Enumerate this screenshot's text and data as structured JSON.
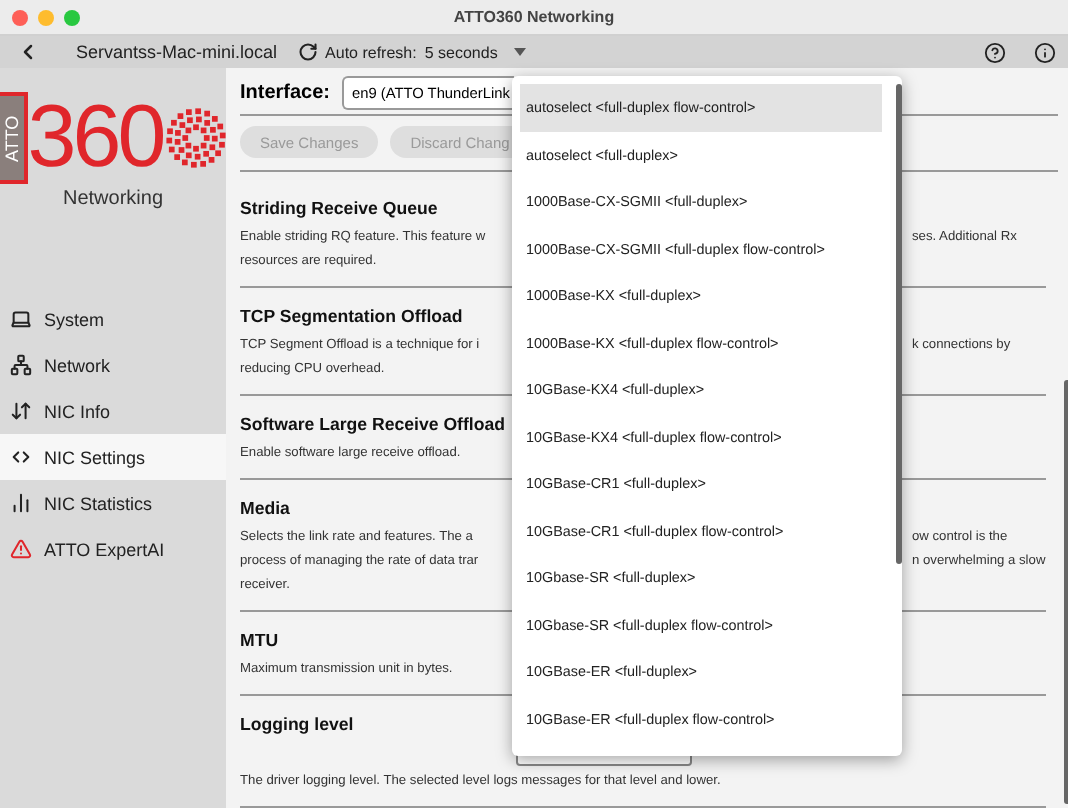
{
  "window": {
    "title": "ATTO360 Networking"
  },
  "toolbar": {
    "host": "Servantss-Mac-mini.local",
    "auto_refresh": "Auto refresh:",
    "interval": "5 seconds"
  },
  "logo": {
    "badge": "ATTO",
    "number": "360",
    "subtitle": "Networking"
  },
  "sidebar": {
    "items": [
      {
        "label": "System",
        "selected": false
      },
      {
        "label": "Network",
        "selected": false
      },
      {
        "label": "NIC Info",
        "selected": false
      },
      {
        "label": "NIC Settings",
        "selected": true
      },
      {
        "label": "NIC Statistics",
        "selected": false
      },
      {
        "label": "ATTO ExpertAI",
        "selected": false
      }
    ]
  },
  "interface": {
    "label": "Interface:",
    "value": "en9 (ATTO ThunderLink"
  },
  "buttons": [
    {
      "label": "Save Changes",
      "disabled": true
    },
    {
      "label": "Discard Chang",
      "disabled": true
    }
  ],
  "sections": [
    {
      "kind": "plain",
      "title": "Striding Receive Queue",
      "left_lines": [
        "Enable striding RQ feature. This feature w",
        "resources are required."
      ],
      "right_lines": [
        "ses. Additional Rx"
      ]
    },
    {
      "kind": "plain",
      "title": "TCP Segmentation Offload",
      "left_lines": [
        "TCP Segment Offload is a technique for i",
        "reducing CPU overhead."
      ],
      "right_lines": [
        "k connections by"
      ]
    },
    {
      "kind": "plain",
      "title": "Software Large Receive Offload",
      "left_lines": [
        "Enable software large receive offload."
      ]
    },
    {
      "kind": "plain",
      "title": "Media",
      "left_lines": [
        "Selects the link rate and features.  The a",
        "process of managing the rate of data trar",
        "receiver."
      ],
      "right_lines": [
        "ow control is the",
        "n overwhelming a slow"
      ]
    },
    {
      "kind": "plain",
      "title": "MTU",
      "left_lines": [
        "Maximum transmission unit in bytes."
      ]
    },
    {
      "kind": "select",
      "title": "Logging level",
      "left_lines": [
        "The driver logging level. The selected level logs messages for that level and lower."
      ]
    }
  ],
  "dropdown": {
    "options": [
      {
        "label": "autoselect <full-duplex flow-control>",
        "selected": true
      },
      {
        "label": "autoselect <full-duplex>",
        "selected": false
      },
      {
        "label": "1000Base-CX-SGMII <full-duplex>",
        "selected": false
      },
      {
        "label": "1000Base-CX-SGMII <full-duplex flow-control>",
        "selected": false
      },
      {
        "label": "1000Base-KX <full-duplex>",
        "selected": false
      },
      {
        "label": "1000Base-KX <full-duplex flow-control>",
        "selected": false
      },
      {
        "label": "10GBase-KX4 <full-duplex>",
        "selected": false
      },
      {
        "label": "10GBase-KX4 <full-duplex flow-control>",
        "selected": false
      },
      {
        "label": "10GBase-CR1 <full-duplex>",
        "selected": false
      },
      {
        "label": "10GBase-CR1 <full-duplex flow-control>",
        "selected": false
      },
      {
        "label": "10Gbase-SR <full-duplex>",
        "selected": false
      },
      {
        "label": "10Gbase-SR <full-duplex flow-control>",
        "selected": false
      },
      {
        "label": "10GBase-ER <full-duplex>",
        "selected": false
      },
      {
        "label": "10GBase-ER <full-duplex flow-control>",
        "selected": false
      }
    ]
  }
}
